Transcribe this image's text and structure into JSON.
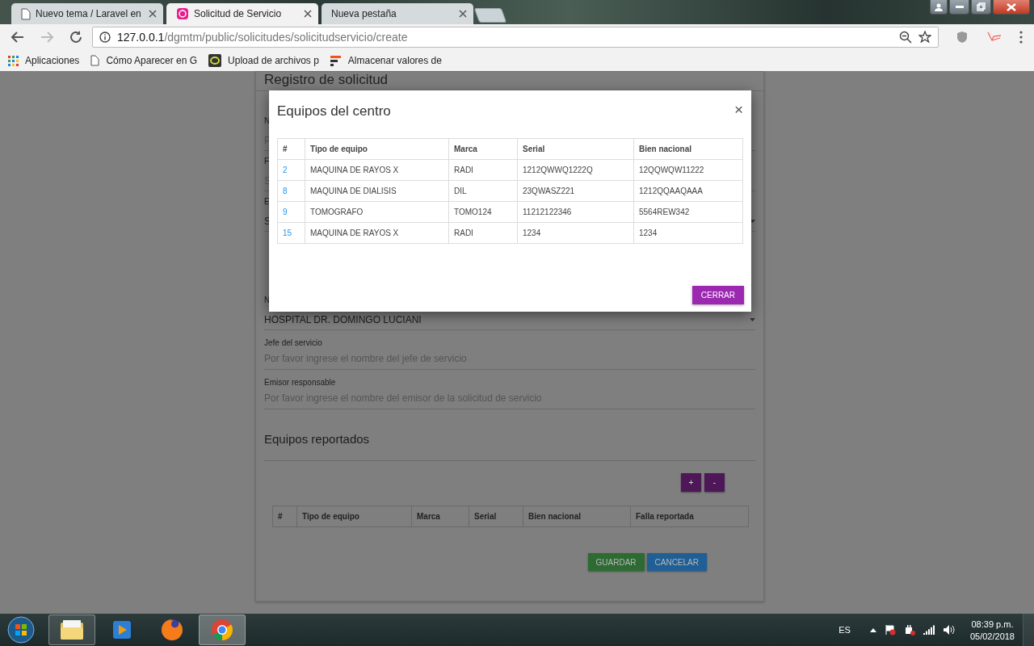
{
  "browser": {
    "tabs": [
      {
        "title": "Nuevo tema / Laravel en",
        "kind": "page",
        "selected": false
      },
      {
        "title": "Solicitud de Servicio",
        "kind": "logo",
        "selected": true
      },
      {
        "title": "Nueva pestaña",
        "kind": "blank",
        "selected": false
      }
    ],
    "url": {
      "host": "127.0.0.1",
      "path": "/dgmtm/public/solicitudes/solicitudservicio/create"
    },
    "bookmarks": [
      {
        "label": "Aplicaciones",
        "kind": "apps"
      },
      {
        "label": "Cómo Aparecer en G",
        "kind": "page"
      },
      {
        "label": "Upload de archivos p",
        "kind": "disc"
      },
      {
        "label": "Almacenar valores de",
        "kind": "flag"
      }
    ]
  },
  "form": {
    "title": "Registro de solicitud",
    "hidden_fields": [
      {
        "kind": "label",
        "text": "N"
      },
      {
        "kind": "placeholder",
        "text": "P"
      },
      {
        "kind": "label",
        "text": "F"
      },
      {
        "kind": "placeholder",
        "text": "S"
      },
      {
        "kind": "label",
        "text": "E"
      },
      {
        "kind": "select",
        "text": "S"
      },
      {
        "kind": "label",
        "text": "N"
      },
      {
        "kind": "select",
        "text": "HOSPITAL DR. DOMINGO LUCIANI"
      }
    ],
    "fields": [
      {
        "label": "Jefe del servicio",
        "placeholder": "Por favor ingrese el nombre del jefe de servicio"
      },
      {
        "label": "Emisor responsable",
        "placeholder": "Por favor ingrese el nombre del emisor de la solicitud de servicio"
      }
    ],
    "section": "Equipos reportados",
    "row_buttons": [
      "+",
      "-"
    ],
    "columns": [
      "#",
      "Tipo de equipo",
      "Marca",
      "Serial",
      "Bien nacional",
      "Falla reportada"
    ],
    "actions": [
      {
        "label": "GUARDAR",
        "kind": "save"
      },
      {
        "label": "CANCELAR",
        "kind": "cancel"
      }
    ]
  },
  "modal": {
    "title": "Equipos del centro",
    "close": "×",
    "columns": [
      "#",
      "Tipo de equipo",
      "Marca",
      "Serial",
      "Bien nacional"
    ],
    "rows": [
      [
        "2",
        "MAQUINA DE RAYOS X",
        "RADI",
        "1212QWWQ1222Q",
        "12QQWQW11222"
      ],
      [
        "8",
        "MAQUINA DE DIALISIS",
        "DIL",
        "23QWASZ221",
        "1212QQAAQAAA"
      ],
      [
        "9",
        "TOMOGRAFO",
        "TOMO124",
        "11212122346",
        "5564REW342"
      ],
      [
        "15",
        "MAQUINA DE RAYOS X",
        "RADI",
        "1234",
        "1234"
      ]
    ],
    "button": "CERRAR"
  },
  "taskbar": {
    "apps": [
      {
        "kind": "explorer",
        "running": true,
        "selected": false
      },
      {
        "kind": "media",
        "running": false,
        "selected": false
      },
      {
        "kind": "firefox",
        "running": false,
        "selected": false
      },
      {
        "kind": "chrome",
        "running": true,
        "selected": true
      }
    ],
    "language": "ES",
    "time": "08:39 p.m.",
    "date": "05/02/2018"
  }
}
